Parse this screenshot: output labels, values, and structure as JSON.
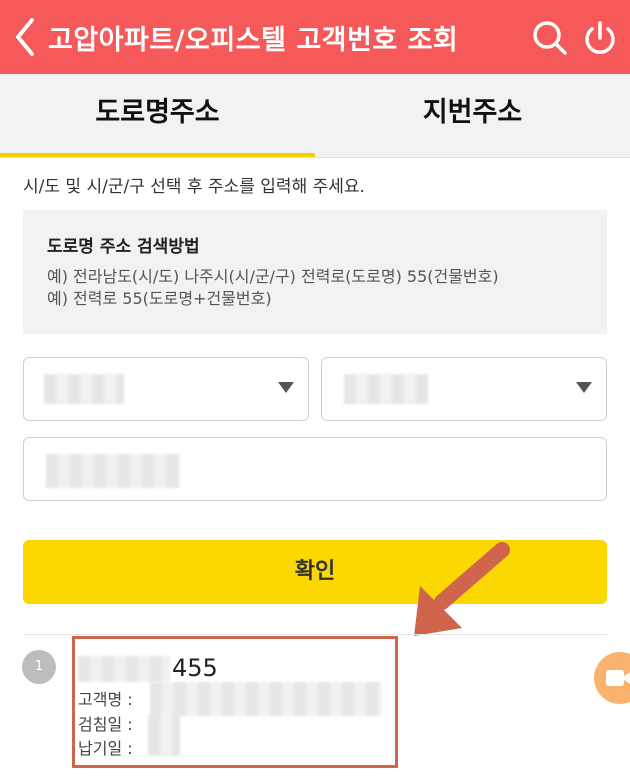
{
  "header": {
    "title": "고압아파트/오피스텔 고객번호 조회",
    "back_icon": "chevron-left-icon",
    "search_icon": "search-icon",
    "power_icon": "power-icon"
  },
  "tabs": [
    {
      "label": "도로명주소",
      "active": true
    },
    {
      "label": "지번주소",
      "active": false
    }
  ],
  "instruction": "시/도 및 시/군/구 선택 후 주소를 입력해 주세요.",
  "guide": {
    "title": "도로명 주소 검색방법",
    "lines": [
      "예) 전라남도(시/도) 나주시(시/군/구) 전력로(도로명) 55(건물번호)",
      "예) 전력로 55(도로명+건물번호)"
    ]
  },
  "form": {
    "confirm_label": "확인"
  },
  "result": {
    "number": "1",
    "title_visible": "455",
    "customer_name_label": "고객명 :",
    "inspection_day_label": "검침일 :",
    "due_day_label": "납기일 :"
  },
  "colors": {
    "header": "#f6595a",
    "tab_indicator": "#f7d000",
    "confirm_button": "#fbd900",
    "annotation": "#d0654d"
  }
}
